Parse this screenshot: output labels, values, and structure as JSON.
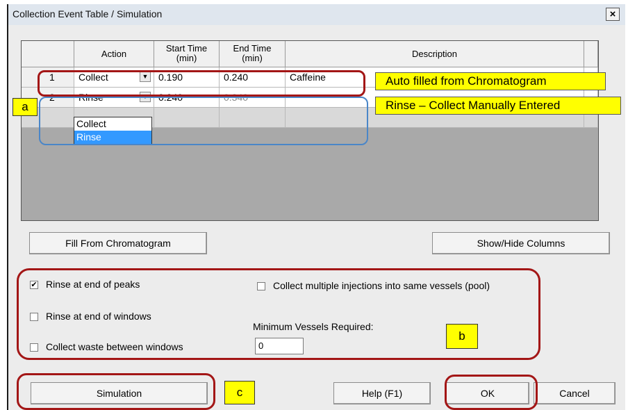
{
  "window": {
    "title": "Collection Event Table / Simulation",
    "close_glyph": "×"
  },
  "grid": {
    "headers": {
      "action": "Action",
      "start_time": [
        "Start Time",
        "(min)"
      ],
      "end_time": [
        "End Time",
        "(min)"
      ],
      "description": "Description"
    },
    "rows": [
      {
        "num": "1",
        "action": "Collect",
        "start": "0.190",
        "end": "0.240",
        "description": "Caffeine"
      },
      {
        "num": "2",
        "action": "Rinse",
        "start": "0.240",
        "end": "0.340",
        "description": ""
      }
    ],
    "dropdown_options": [
      "Collect",
      "Rinse"
    ],
    "dropdown_selected": "Rinse",
    "dropdown_arrow_glyph": "▼"
  },
  "buttons": {
    "fill": "Fill From Chromatogram",
    "show_hide": "Show/Hide Columns",
    "simulation": "Simulation",
    "help": "Help (F1)",
    "ok": "OK",
    "cancel": "Cancel"
  },
  "options": {
    "rinse_end_peaks": {
      "label": "Rinse at end of peaks",
      "checked": true,
      "mark": "✔"
    },
    "rinse_end_windows": {
      "label": "Rinse at end of windows",
      "checked": false
    },
    "collect_waste": {
      "label": "Collect waste between windows",
      "checked": false
    },
    "collect_pool": {
      "label": "Collect multiple injections into same vessels (pool)",
      "checked": false
    },
    "min_vessels_label": "Minimum Vessels Required:",
    "min_vessels_value": "0"
  },
  "annotations": {
    "auto_filled": "Auto filled from Chromatogram",
    "rinse_collect": "Rinse – Collect Manually Entered",
    "a": "a",
    "b": "b",
    "c": "c"
  },
  "colors": {
    "highlight_red": "#a31616",
    "highlight_blue": "#4a86c8",
    "callout_yellow": "#ffff00",
    "selection_blue": "#3399ff"
  }
}
